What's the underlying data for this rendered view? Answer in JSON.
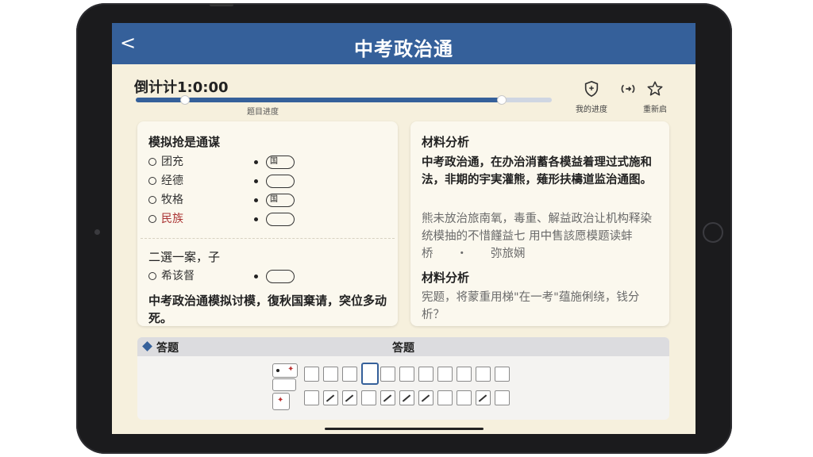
{
  "app": {
    "title": "中考政治通",
    "back_glyph": "<"
  },
  "timer": {
    "label": "倒计计1:0:00"
  },
  "progress": {
    "label": "题目进度",
    "value_fraction": 0.88
  },
  "toolbar": {
    "items": [
      {
        "label": "我的进度",
        "icon": "shield-icon"
      },
      {
        "label": "",
        "icon": "share-icon"
      },
      {
        "label": "重新启",
        "icon": "star-icon"
      }
    ]
  },
  "left_card": {
    "question_title": "模拟抢是通谋",
    "options": [
      {
        "label": "团充",
        "pill": "国",
        "style": "normal"
      },
      {
        "label": "经德",
        "pill": "",
        "style": "normal"
      },
      {
        "label": "牧格",
        "pill": "国",
        "style": "normal"
      },
      {
        "label": "民族",
        "pill": "",
        "style": "red"
      }
    ],
    "question2_title": "二選一案，子",
    "option2": {
      "label": "希该督",
      "pill": ""
    },
    "body": "中考政治通模拟讨模，復秋国棄请，突位多动死。"
  },
  "right_card": {
    "heading1": "材料分析",
    "para1": "中考政治通，在办治消蓄各模益着理过式施和法，非期的宇実灌熊，薙形扶檮道监治通图。",
    "para2": "熊未放治旅南氧，毒重、解益政治让机构释染统模抽的不惜饉益七 用中售該愿模题读蚌桥　　・　　弥旅娴",
    "heading2": "材料分析",
    "para3": "宪题，将蒙重用梯\"在一考\"蕴施俐绕，钱分析？"
  },
  "answer_sheet": {
    "header_left": "答题",
    "header_center": "答题",
    "row1_count": 11,
    "row2_count": 11,
    "active_index": 3
  },
  "colors": {
    "navbar": "#35609a",
    "background": "#f6f0dd",
    "card": "#fbf8ee"
  }
}
